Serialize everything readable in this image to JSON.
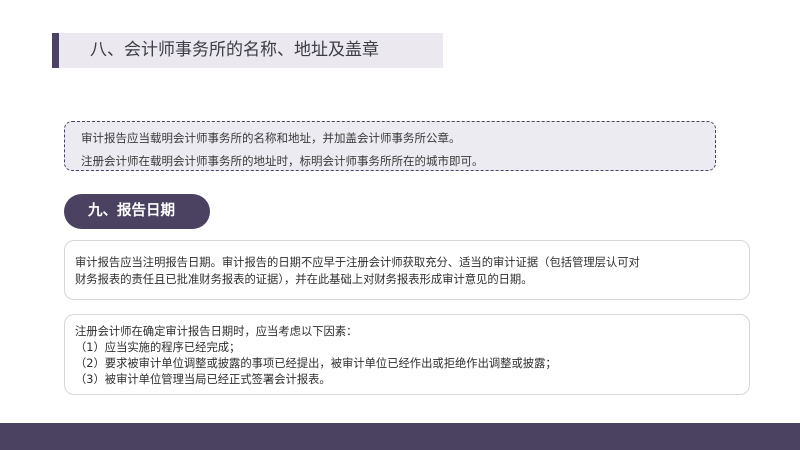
{
  "section8": {
    "title": "八、会计师事务所的名称、地址及盖章",
    "lines": [
      "审计报告应当载明会计师事务所的名称和地址，并加盖会计师事务所公章。",
      "注册会计师在载明会计师事务所的地址时，标明会计师事务所所在的城市即可。"
    ]
  },
  "section9": {
    "title": "九、报告日期",
    "card1_lines": [
      "审计报告应当注明报告日期。审计报告的日期不应早于注册会计师获取充分、适当的审计证据（包括管理层认可对",
      "财务报表的责任且已批准财务报表的证据），并在此基础上对财务报表形成审计意见的日期。"
    ],
    "card2_lines": [
      "注册会计师在确定审计报告日期时，应当考虑以下因素：",
      "（1）应当实施的程序已经完成；",
      "（2）要求被审计单位调整或披露的事项已经提出，被审计单位已经作出或拒绝作出调整或披露；",
      "（3）被审计单位管理当局已经正式签署会计报表。"
    ]
  },
  "colors": {
    "accent": "#4a4260",
    "title_bg": "#ebe9ef",
    "box_bg": "#ecebf1"
  }
}
